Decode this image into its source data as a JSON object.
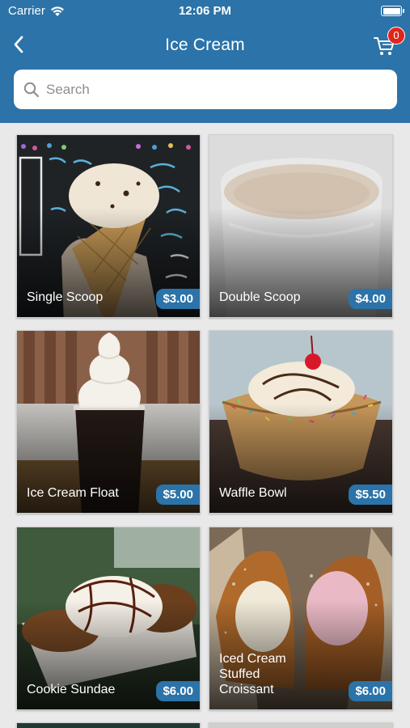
{
  "status_bar": {
    "carrier": "Carrier",
    "time": "12:06 PM"
  },
  "nav": {
    "title": "Ice Cream",
    "cart_count": "0"
  },
  "search": {
    "placeholder": "Search"
  },
  "products": [
    {
      "name": "Single Scoop",
      "price": "$3.00"
    },
    {
      "name": "Double Scoop",
      "price": "$4.00"
    },
    {
      "name": "Ice Cream Float",
      "price": "$5.00"
    },
    {
      "name": "Waffle Bowl",
      "price": "$5.50"
    },
    {
      "name": "Cookie Sundae",
      "price": "$6.00"
    },
    {
      "name": "Iced Cream Stuffed Croissant",
      "price": "$6.00"
    }
  ],
  "colors": {
    "header": "#2b73a8",
    "price_tag": "#2b73a8",
    "badge": "#e1251b",
    "background": "#e9e9ea"
  },
  "icons": {
    "back": "chevron-left-icon",
    "cart": "cart-icon",
    "search": "search-icon",
    "wifi": "wifi-icon",
    "battery": "battery-icon"
  }
}
